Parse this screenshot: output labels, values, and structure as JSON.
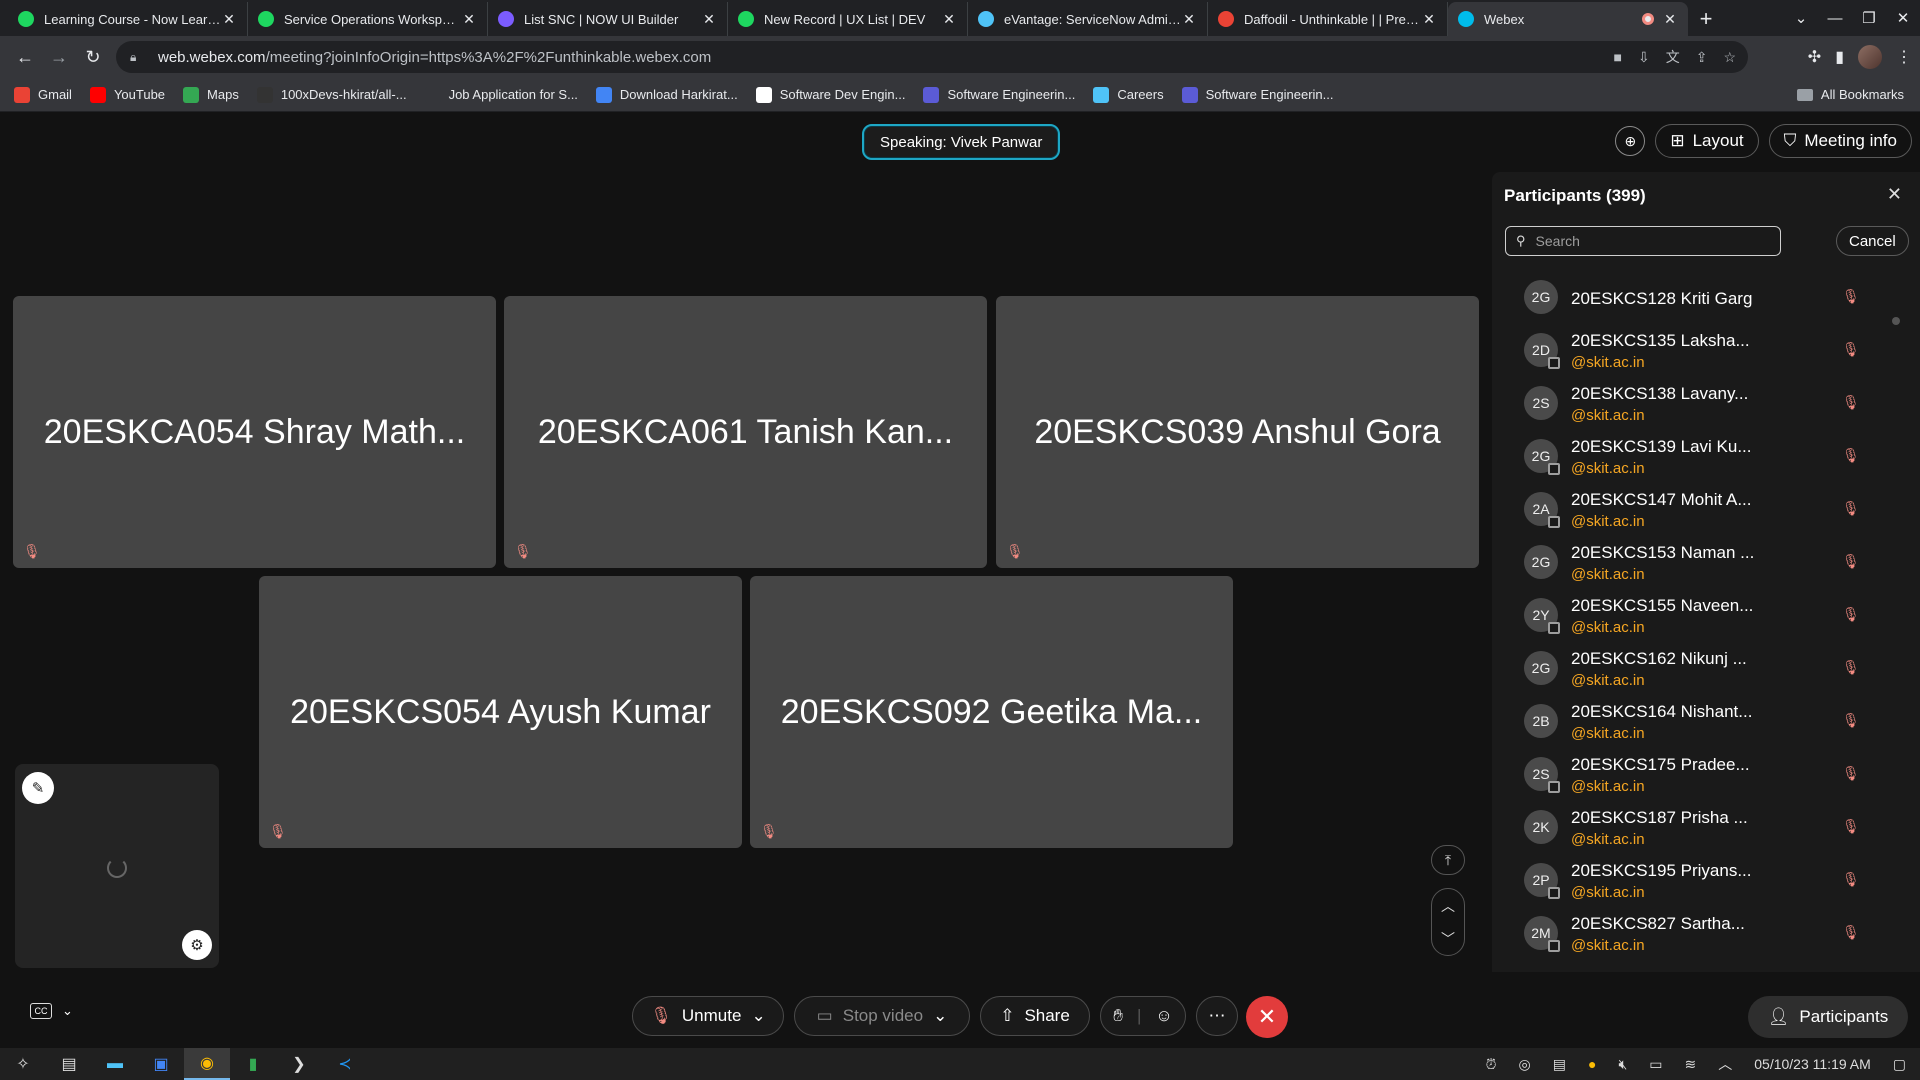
{
  "browser": {
    "tabs": [
      {
        "title": "Learning Course - Now Learning",
        "icon": "now-learning-icon",
        "color": "#1ed760"
      },
      {
        "title": "Service Operations Workspace",
        "icon": "servicenow-icon",
        "color": "#1ed760"
      },
      {
        "title": "List SNC | NOW UI Builder",
        "icon": "ui-builder-icon",
        "color": "#7b5cff"
      },
      {
        "title": "New Record | UX List | DEV",
        "icon": "servicenow-icon",
        "color": "#1ed760"
      },
      {
        "title": "eVantage: ServiceNow Administration",
        "icon": "evantage-icon",
        "color": "#4fc3f7"
      },
      {
        "title": "Daffodil - Unthinkable | | Pre Placement",
        "icon": "gmail-icon",
        "color": "#ea4335"
      },
      {
        "title": "Webex",
        "icon": "webex-icon",
        "color": "#00bceb",
        "active": true
      }
    ],
    "url_host": "web.webex.com",
    "url_path": "/meeting?joinInfoOrigin=https%3A%2F%2Funthinkable.webex.com",
    "bookmarks": [
      {
        "label": "Gmail",
        "icon": "gmail-icon",
        "color": "#ea4335"
      },
      {
        "label": "YouTube",
        "icon": "youtube-icon",
        "color": "#ff0000"
      },
      {
        "label": "Maps",
        "icon": "maps-icon",
        "color": "#34a853"
      },
      {
        "label": "100xDevs-hkirat/all-...",
        "icon": "github-icon",
        "color": "#333333"
      },
      {
        "label": "Job Application for S...",
        "icon": "blank-icon",
        "color": "#35363a"
      },
      {
        "label": "Download Harkirat...",
        "icon": "download-icon",
        "color": "#4285f4"
      },
      {
        "label": "Software Dev Engin...",
        "icon": "amazon-icon",
        "color": "#ffffff"
      },
      {
        "label": "Software Engineerin...",
        "icon": "s-icon",
        "color": "#5b5bd6"
      },
      {
        "label": "Careers",
        "icon": "careers-icon",
        "color": "#4fc3f7"
      },
      {
        "label": "Software Engineerin...",
        "icon": "s-icon",
        "color": "#5b5bd6"
      }
    ],
    "all_bookmarks": "All Bookmarks"
  },
  "meeting": {
    "speaking": "Speaking: Vivek Panwar",
    "layout_label": "Layout",
    "meeting_info_label": "Meeting info",
    "tiles": [
      "20ESKCA054 Shray Math...",
      "20ESKCA061 Tanish Kan...",
      "20ESKCS039 Anshul Gora",
      "20ESKCS054 Ayush Kumar",
      "20ESKCS092 Geetika Ma..."
    ]
  },
  "participants": {
    "title": "Participants (399)",
    "search_placeholder": "Search",
    "cancel_label": "Cancel",
    "list": [
      {
        "initials": "2G",
        "name": "20ESKCS128 Kriti Garg",
        "email": "",
        "device": false
      },
      {
        "initials": "2D",
        "name": "20ESKCS135 Laksha...",
        "email": "@skit.ac.in",
        "device": true
      },
      {
        "initials": "2S",
        "name": "20ESKCS138 Lavany...",
        "email": "@skit.ac.in",
        "device": false
      },
      {
        "initials": "2G",
        "name": "20ESKCS139 Lavi Ku...",
        "email": "@skit.ac.in",
        "device": true
      },
      {
        "initials": "2A",
        "name": "20ESKCS147 Mohit A...",
        "email": "@skit.ac.in",
        "device": true
      },
      {
        "initials": "2G",
        "name": "20ESKCS153 Naman ...",
        "email": "@skit.ac.in",
        "device": false
      },
      {
        "initials": "2Y",
        "name": "20ESKCS155 Naveen...",
        "email": "@skit.ac.in",
        "device": true
      },
      {
        "initials": "2G",
        "name": "20ESKCS162 Nikunj ...",
        "email": "@skit.ac.in",
        "device": false
      },
      {
        "initials": "2B",
        "name": "20ESKCS164 Nishant...",
        "email": "@skit.ac.in",
        "device": false
      },
      {
        "initials": "2S",
        "name": "20ESKCS175 Pradee...",
        "email": "@skit.ac.in",
        "device": true
      },
      {
        "initials": "2K",
        "name": "20ESKCS187 Prisha ...",
        "email": "@skit.ac.in",
        "device": false
      },
      {
        "initials": "2P",
        "name": "20ESKCS195 Priyans...",
        "email": "@skit.ac.in",
        "device": true
      },
      {
        "initials": "2M",
        "name": "20ESKCS827 Sartha...",
        "email": "@skit.ac.in",
        "device": true
      }
    ]
  },
  "controls": {
    "unmute": "Unmute",
    "stop_video": "Stop video",
    "share": "Share",
    "participants": "Participants"
  },
  "taskbar": {
    "date": "05/10/23",
    "time": "11:19 AM"
  }
}
